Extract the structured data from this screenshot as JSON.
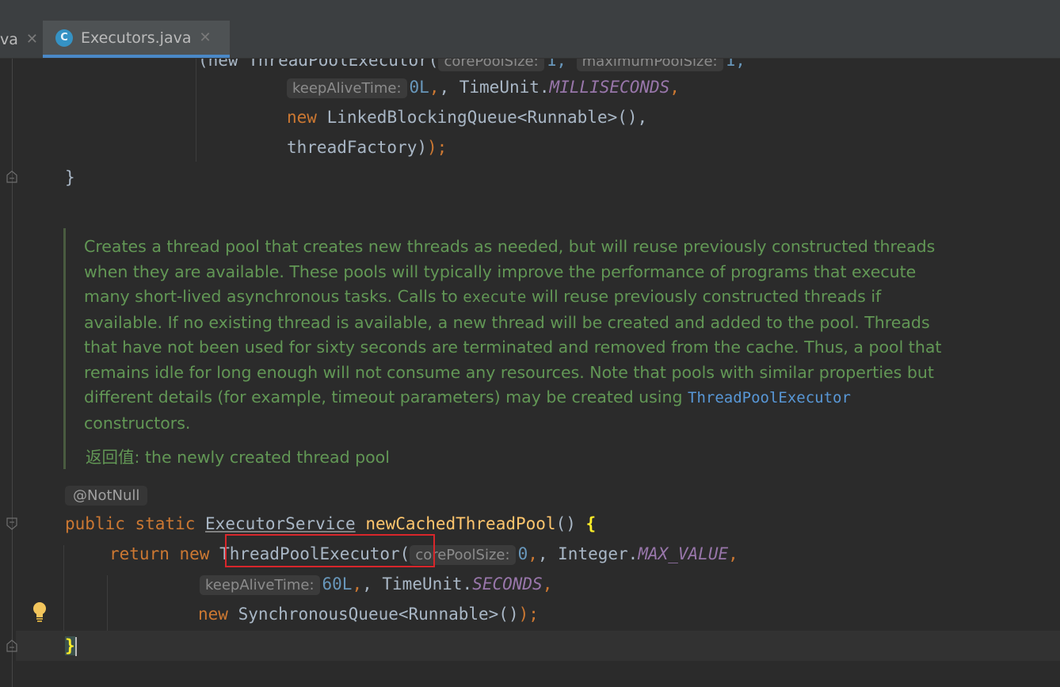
{
  "tabs": [
    {
      "label": "va",
      "active": false
    },
    {
      "label": "Executors.java",
      "active": true,
      "icon": "C"
    }
  ],
  "code_top": {
    "line0_prefix": "(new ThreadPoolExecutor(",
    "line0_hint1": "corePoolSize:",
    "line0_val1": "1,",
    "line0_hint2": "maximumPoolSize:",
    "line0_val2": "1,",
    "line1_hint": "keepAliveTime:",
    "line1_num": "0L",
    "line1_sep": ", TimeUnit.",
    "line1_const": "MILLISECONDS",
    "line1_end": ",",
    "line2_kw": "new",
    "line2_text": " LinkedBlockingQueue<Runnable>(),",
    "line3_text": "threadFactory)",
    "line3_end": ");",
    "line4_text": "}"
  },
  "doc": {
    "p1": "Creates a thread pool that creates new threads as needed, but will reuse previously constructed threads when they are available. These pools will typically improve the performance of programs that execute many short-lived asynchronous tasks. Calls to ",
    "execute_code": "execute",
    "p2": " will reuse previously constructed threads if available. If no existing thread is available, a new thread will be created and added to the pool. Threads that have not been used for sixty seconds are terminated and removed from the cache. Thus, a pool that remains idle for long enough will not consume any resources. Note that pools with similar properties but different details (for example, timeout parameters) may be created using ",
    "link": "ThreadPoolExecutor",
    "p3": " constructors.",
    "return_label": "返回值:",
    "return_text": " the newly created thread pool"
  },
  "code_bottom": {
    "annotation": "@NotNull",
    "sig_kw": "public static",
    "sig_type": "ExecutorService",
    "sig_name": "newCachedThreadPool",
    "sig_end": "() ",
    "sig_brace": "{",
    "ret_kw": "return new",
    "ret_class": "ThreadPoolExecutor(",
    "ret_hint": "corePoolSize:",
    "ret_num": "0",
    "ret_sep": ", Integer.",
    "ret_const": "MAX_VALUE",
    "ret_end": ",",
    "ka_hint": "keepAliveTime:",
    "ka_num": "60L",
    "ka_sep": ", TimeUnit.",
    "ka_const": "SECONDS",
    "ka_end": ",",
    "sq_kw": "new",
    "sq_text": " SynchronousQueue<Runnable>()",
    "sq_end": ");",
    "close_brace": "}"
  },
  "colors": {
    "background": "#2b2b2b",
    "keyword": "#cc7832",
    "number": "#6897bb",
    "constant": "#9876aa",
    "method": "#ffc66d",
    "doc": "#629755",
    "highlight_box": "#d8262b"
  }
}
